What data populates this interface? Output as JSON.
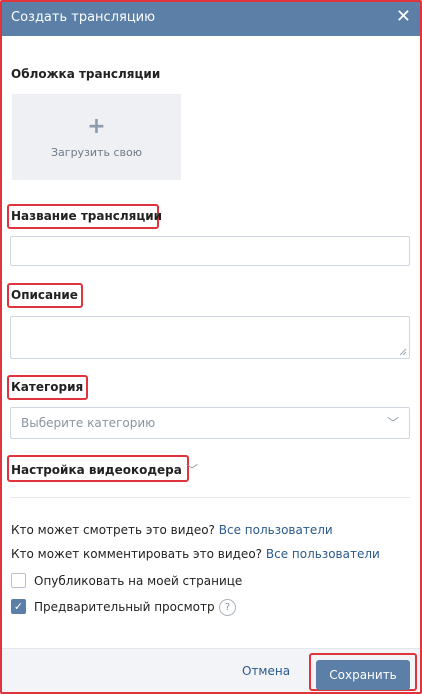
{
  "dialog": {
    "title": "Создать трансляцию",
    "close_icon": "close-icon"
  },
  "cover": {
    "label": "Обложка трансляции",
    "upload_label": "Загрузить свою",
    "icon": "plus-icon"
  },
  "name": {
    "label": "Название трансляции",
    "value": ""
  },
  "description": {
    "label": "Описание",
    "value": ""
  },
  "category": {
    "label": "Категория",
    "placeholder": "Выберите категорию"
  },
  "encoder": {
    "label": "Настройка видеокодера"
  },
  "privacy": {
    "view_question": "Кто может смотреть это видео?",
    "view_value": "Все пользователи",
    "comment_question": "Кто может комментировать это видео?",
    "comment_value": "Все пользователи"
  },
  "options": [
    {
      "label": "Опубликовать на моей странице",
      "checked": false
    },
    {
      "label": "Предварительный просмотр",
      "checked": true
    }
  ],
  "help_glyph": "?",
  "footer": {
    "cancel_label": "Отмена",
    "save_label": "Сохранить"
  },
  "colors": {
    "header": "#5b7fa6",
    "highlight": "#e0343d",
    "link": "#2b5a8a"
  }
}
